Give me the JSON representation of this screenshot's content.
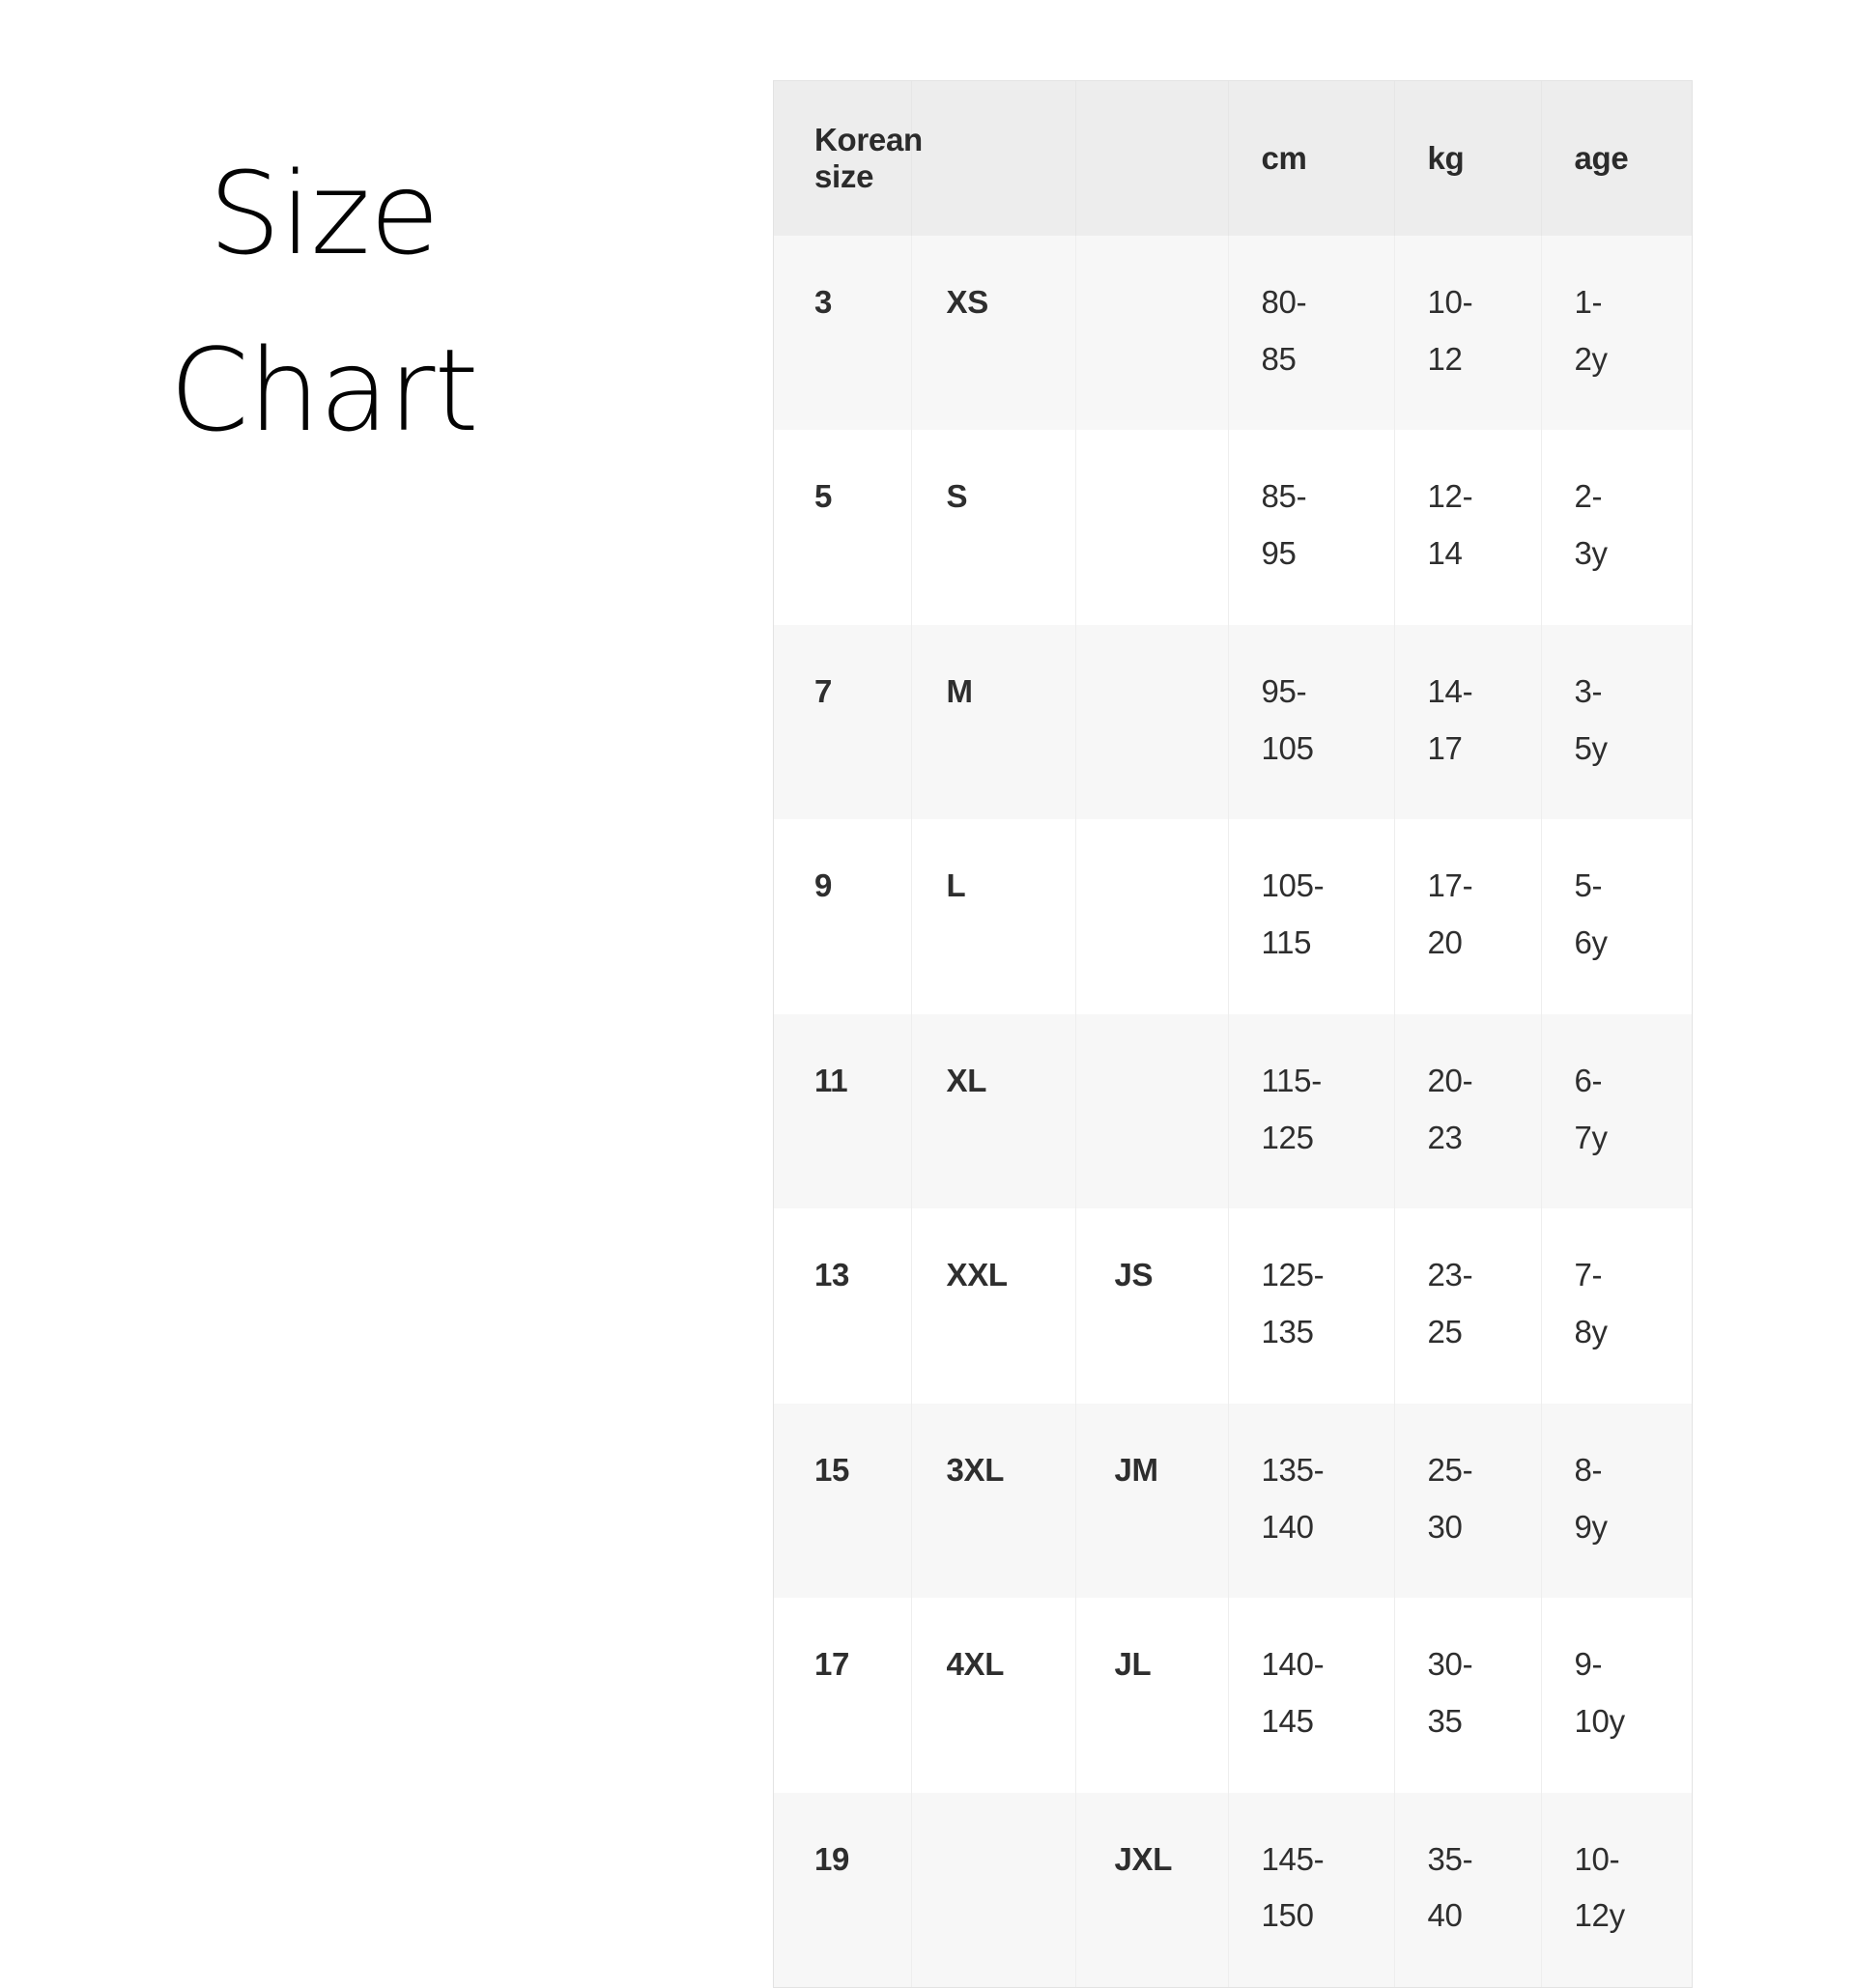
{
  "title": {
    "line1": "Size",
    "line2": "Chart"
  },
  "colors": {
    "header_background": "#ededed",
    "row_alt_background": "#f7f7f7",
    "row_plain_background": "#ffffff",
    "border": "#e3e3e3",
    "text": "#2e2e2e",
    "title_text": "#030303"
  },
  "chart_data": {
    "type": "table",
    "title": "Size Chart",
    "columns": [
      "Korean size",
      "",
      "",
      "cm",
      "kg",
      "age"
    ],
    "rows": [
      {
        "korean_size": "3",
        "intl": "XS",
        "jp": "",
        "cm": "80-\n85",
        "kg": "10-\n12",
        "age": "1-\n2y"
      },
      {
        "korean_size": "5",
        "intl": "S",
        "jp": "",
        "cm": "85-\n95",
        "kg": "12-\n14",
        "age": "2-\n3y"
      },
      {
        "korean_size": "7",
        "intl": "M",
        "jp": "",
        "cm": "95-\n105",
        "kg": "14-\n17",
        "age": "3-\n5y"
      },
      {
        "korean_size": "9",
        "intl": "L",
        "jp": "",
        "cm": "105-\n115",
        "kg": "17-\n20",
        "age": "5-\n6y"
      },
      {
        "korean_size": "11",
        "intl": "XL",
        "jp": "",
        "cm": "115-\n125",
        "kg": "20-\n23",
        "age": "6-\n7y"
      },
      {
        "korean_size": "13",
        "intl": "XXL",
        "jp": "JS",
        "cm": "125-\n135",
        "kg": "23-\n25",
        "age": "7-\n8y"
      },
      {
        "korean_size": "15",
        "intl": "3XL",
        "jp": "JM",
        "cm": "135-\n140",
        "kg": "25-\n30",
        "age": "8-\n9y"
      },
      {
        "korean_size": "17",
        "intl": "4XL",
        "jp": "JL",
        "cm": "140-\n145",
        "kg": "30-\n35",
        "age": "9-\n10y"
      },
      {
        "korean_size": "19",
        "intl": "",
        "jp": "JXL",
        "cm": "145-\n150",
        "kg": "35-\n40",
        "age": "10-\n12y"
      }
    ]
  },
  "table": {
    "headers": {
      "korean_size": "Korean size",
      "intl": "",
      "jp": "",
      "cm": "cm",
      "kg": "kg",
      "age": "age"
    },
    "rows": [
      {
        "korean_size": "3",
        "intl": "XS",
        "jp": "",
        "cm": "80-\n85",
        "kg": "10-\n12",
        "age": "1-\n2y"
      },
      {
        "korean_size": "5",
        "intl": "S",
        "jp": "",
        "cm": "85-\n95",
        "kg": "12-\n14",
        "age": "2-\n3y"
      },
      {
        "korean_size": "7",
        "intl": "M",
        "jp": "",
        "cm": "95-\n105",
        "kg": "14-\n17",
        "age": "3-\n5y"
      },
      {
        "korean_size": "9",
        "intl": "L",
        "jp": "",
        "cm": "105-\n115",
        "kg": "17-\n20",
        "age": "5-\n6y"
      },
      {
        "korean_size": "11",
        "intl": "XL",
        "jp": "",
        "cm": "115-\n125",
        "kg": "20-\n23",
        "age": "6-\n7y"
      },
      {
        "korean_size": "13",
        "intl": "XXL",
        "jp": "JS",
        "cm": "125-\n135",
        "kg": "23-\n25",
        "age": "7-\n8y"
      },
      {
        "korean_size": "15",
        "intl": "3XL",
        "jp": "JM",
        "cm": "135-\n140",
        "kg": "25-\n30",
        "age": "8-\n9y"
      },
      {
        "korean_size": "17",
        "intl": "4XL",
        "jp": "JL",
        "cm": "140-\n145",
        "kg": "30-\n35",
        "age": "9-\n10y"
      },
      {
        "korean_size": "19",
        "intl": "",
        "jp": "JXL",
        "cm": "145-\n150",
        "kg": "35-\n40",
        "age": "10-\n12y"
      }
    ]
  }
}
